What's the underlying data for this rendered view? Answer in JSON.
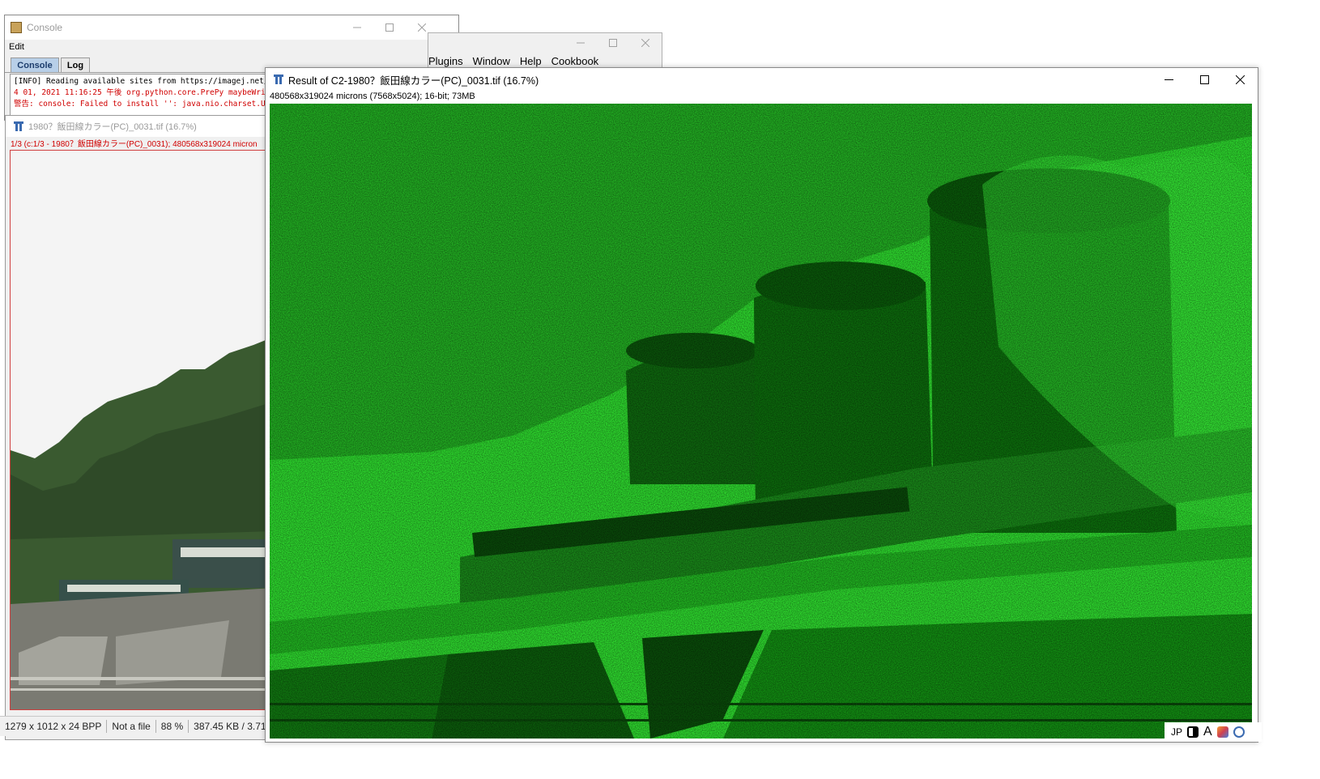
{
  "console_window": {
    "title": "Console",
    "menu": [
      "Edit"
    ],
    "tabs": [
      "Console",
      "Log"
    ],
    "lines": [
      {
        "text": "[INFO] Reading available sites from https://imagej.net/",
        "level": "info"
      },
      {
        "text": "4 01, 2021 11:16:25 午後 org.python.core.PrePy maybeWrite",
        "level": "error"
      },
      {
        "text": "警告: console: Failed to install '': java.nio.charset.Unsuppo",
        "level": "error"
      }
    ]
  },
  "imagej_window": {
    "menu": [
      "Plugins",
      "Window",
      "Help",
      "Cookbook"
    ]
  },
  "source_window": {
    "title": "1980？飯田線カラー(PC)_0031.tif (16.7%)",
    "info": "1/3 (c:1/3 - 1980？飯田線カラー(PC)_0031); 480568x319024 micron"
  },
  "status_bar": {
    "dimensions": "1279 x 1012 x 24 BPP",
    "file_state": "Not a file",
    "zoom": "88 %",
    "size": "387.45 KB / 3.71"
  },
  "result_window": {
    "title": "Result of C2-1980？飯田線カラー(PC)_0031.tif (16.7%)",
    "info": "480568x319024 microns (7568x5024); 16-bit; 73MB",
    "lut_color": "#2dcc2d"
  },
  "tray": {
    "language": "JP",
    "font_glyph": "A"
  },
  "icons": {
    "minimize": "minimize-icon",
    "maximize": "maximize-icon",
    "close": "close-icon"
  }
}
